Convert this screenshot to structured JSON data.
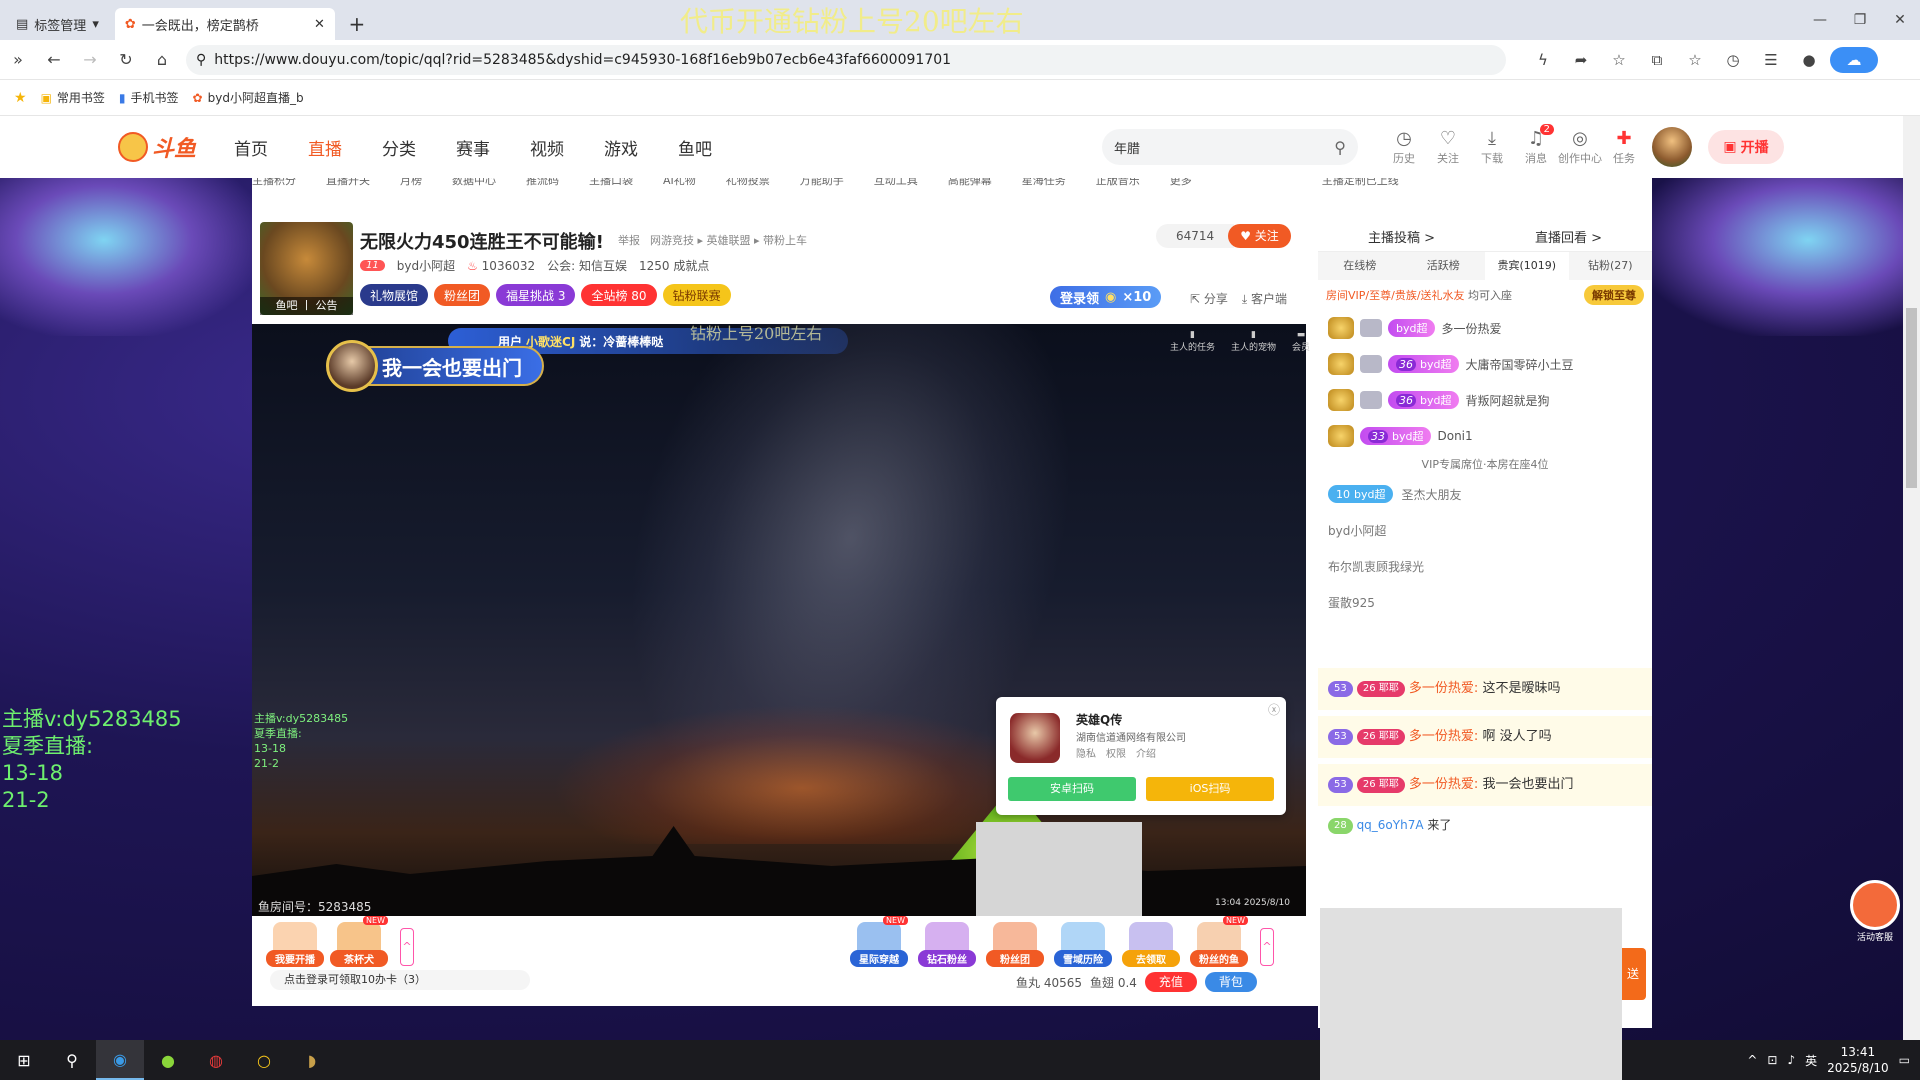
{
  "browser": {
    "tab_bookmarks_label": "标签管理",
    "tab_active_title": "一会既出，榜定鹊桥",
    "tab_overlay_text": "代币开通钻粉上号20吧左右",
    "url": "https://www.douyu.com/topic/qql?rid=5283485&dyshid=c945930-168f16eb9b07ecb6e43faf6600091701",
    "bookmarks": [
      "常用书签",
      "手机书签",
      "byd小阿超直播_b"
    ]
  },
  "header": {
    "logo_text": "斗鱼",
    "nav": [
      "首页",
      "直播",
      "分类",
      "赛事",
      "视频",
      "游戏",
      "鱼吧"
    ],
    "search_value": "年腊",
    "icons": [
      {
        "label": "历史",
        "icon": "history-icon"
      },
      {
        "label": "关注",
        "icon": "follow-icon"
      },
      {
        "label": "下载",
        "icon": "download-icon"
      },
      {
        "label": "消息",
        "icon": "message-icon",
        "badge": "2"
      },
      {
        "label": "创作中心",
        "icon": "creator-icon"
      },
      {
        "label": "任务",
        "icon": "task-icon"
      }
    ],
    "live_button": "开播"
  },
  "subnav": [
    "主播积分",
    "直播开关",
    "月榜",
    "数据中心",
    "推流码",
    "主播口袋",
    "AI礼物",
    "礼物投票",
    "万能助手",
    "互动工具",
    "高能弹幕",
    "星海任务",
    "正版音乐",
    "更多",
    "主播定制已上线"
  ],
  "room": {
    "avatar_caption": "鱼吧 丨 公告",
    "title": "无限火力450连胜王不可能输!",
    "tags": [
      "举报",
      "网游竞技 ▸ 英雄联盟 ▸ 带粉上车"
    ],
    "level": "11",
    "streamer": "byd小阿超",
    "heat": "1036032",
    "guild": "公会: 知信互娱",
    "points": "1250 成就点",
    "badges": [
      "礼物展馆",
      "粉丝团",
      "福星挑战 3",
      "全站榜 80",
      "钻粉联赛"
    ],
    "followers": "64714",
    "follow_label": "关注",
    "login_gift": "登录领",
    "login_gift_count": "×10",
    "share": "分享",
    "client": "客户端"
  },
  "player": {
    "notice_user": "小歌迷CJ",
    "notice_text_prefix": "用户",
    "notice_text_suffix": "说：冷蔷棒棒哒",
    "banner_text": "我一会也要出门",
    "overlay_text": "钻粉上号20吧左右",
    "video_text": [
      "主播v:dy5283485",
      "夏季直播:",
      "13-18",
      "21-2"
    ],
    "room_id_text": "鱼房间号：5283485",
    "top_icons": [
      "主人的任务",
      "主人的宠物",
      "会员"
    ],
    "time": "13:04",
    "date": "2025/8/10"
  },
  "side_text": [
    "主播v:dy5283485",
    "夏季直播:",
    "13-18",
    "21-2"
  ],
  "app_popup": {
    "name": "英雄Q传",
    "company": "湖南信道通网络有限公司",
    "links": [
      "隐私",
      "权限",
      "介绍"
    ],
    "android": "安卓扫码",
    "ios": "iOS扫码"
  },
  "gift_bar": {
    "left_gifts": [
      {
        "label": "我要开播",
        "color": "#f15a24"
      },
      {
        "label": "茶杯犬",
        "color": "#f15a24",
        "new": true
      }
    ],
    "right_gifts": [
      {
        "label": "星际穿越",
        "color": "#2a64d6",
        "new": true
      },
      {
        "label": "钻石粉丝",
        "color": "#8a3ad6"
      },
      {
        "label": "粉丝团",
        "color": "#f15a24"
      },
      {
        "label": "雪域历险",
        "color": "#2a64d6"
      },
      {
        "label": "去领取",
        "color": "#f5a20a"
      },
      {
        "label": "粉丝的鱼",
        "color": "#f15a24",
        "new": true
      }
    ],
    "new_label": "NEW",
    "hint": "点击登录可领取10办卡（3）",
    "fish_balls": "鱼丸 40565",
    "fish_fins": "鱼翅 0.4",
    "recharge": "充值",
    "backpack": "背包"
  },
  "rank_panel": {
    "top_tabs": [
      "主播投稿 >",
      "直播回看 >"
    ],
    "tabs": [
      "在线榜",
      "活跃榜",
      "贵宾(1019)",
      "钻粉(27)"
    ],
    "vip_hint": "房间VIP/至尊/贵族/送礼水友",
    "vip_hint_suffix": "均可入座",
    "unlock": "解锁至尊",
    "rows": [
      {
        "level": "",
        "badge": "byd超",
        "name": "多一份热爱"
      },
      {
        "level": "36",
        "badge": "byd超",
        "name": "大庸帝国零碎小土豆"
      },
      {
        "level": "36",
        "badge": "byd超",
        "name": "背叛阿超就是狗"
      },
      {
        "level": "33",
        "badge": "byd超",
        "name": "Doni1"
      }
    ],
    "vip_divider": "VIP专属席位·本房在座4位",
    "blue_row": {
      "level": "10",
      "badge": "byd超",
      "name": "圣杰大朋友"
    },
    "plain_rows": [
      "byd小阿超",
      "布尔凯衷顾我绿光",
      "蛋散925"
    ]
  },
  "chat": {
    "messages": [
      {
        "level": "53",
        "badge": "26 耶耶",
        "nick": "多一份热爱:",
        "text": "这不是暧昧吗"
      },
      {
        "level": "53",
        "badge": "26 耶耶",
        "nick": "多一份热爱:",
        "text": "啊 没人了吗"
      },
      {
        "level": "53",
        "badge": "26 耶耶",
        "nick": "多一份热爱:",
        "text": "我一会也要出门"
      }
    ],
    "enter": {
      "level": "28",
      "nick": "qq_6oYh7A",
      "text": "来了"
    },
    "send": "送"
  },
  "kefu_label": "活动客服",
  "taskbar": {
    "lang": "英",
    "time": "13:41",
    "date": "2025/8/10"
  }
}
